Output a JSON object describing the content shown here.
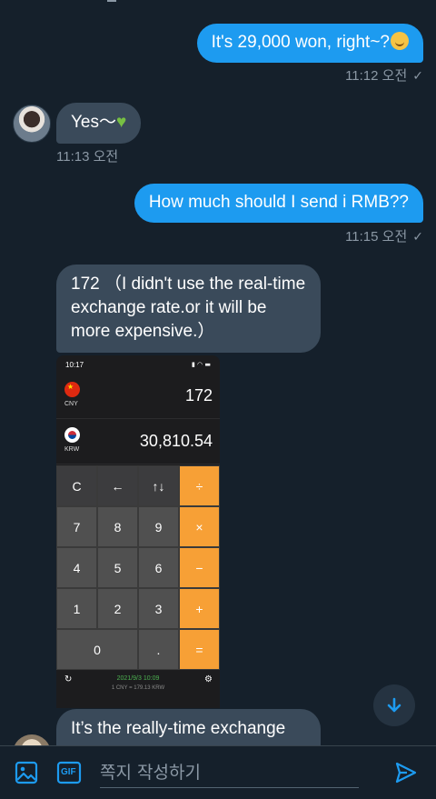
{
  "messages": [
    {
      "text": "It's 29,000 won, right~?",
      "time": "11:12 오전"
    },
    {
      "text": "Yes～",
      "time": "11:13 오전"
    },
    {
      "text": "How much should I send i RMB??",
      "time": "11:15 오전"
    },
    {
      "text": "172 （I didn't use the real-time exchange rate.or it will be more expensive.）"
    },
    {
      "text": "It’s the really-time exchange"
    }
  ],
  "read_check": "✓",
  "calculator": {
    "status_time": "10:17",
    "from": {
      "code": "CNY",
      "value": "172"
    },
    "to": {
      "code": "KRW",
      "value": "30,810.54"
    },
    "keys": [
      "C",
      "←",
      "↑↓",
      "÷",
      "7",
      "8",
      "9",
      "×",
      "4",
      "5",
      "6",
      "−",
      "1",
      "2",
      "3",
      "+",
      "0",
      ".",
      "="
    ],
    "footer_date": "2021/9/3 10:09",
    "footer_rate": "1 CNY = 179.13 KRW"
  },
  "composer": {
    "placeholder": "쪽지 작성하기",
    "gif_label": "GIF"
  },
  "colors": {
    "background": "#15202b",
    "outgoing_bubble": "#1d9bf0",
    "incoming_bubble": "#3a4a5a",
    "accent": "#1d9bf0",
    "calc_operator": "#f7a036"
  }
}
